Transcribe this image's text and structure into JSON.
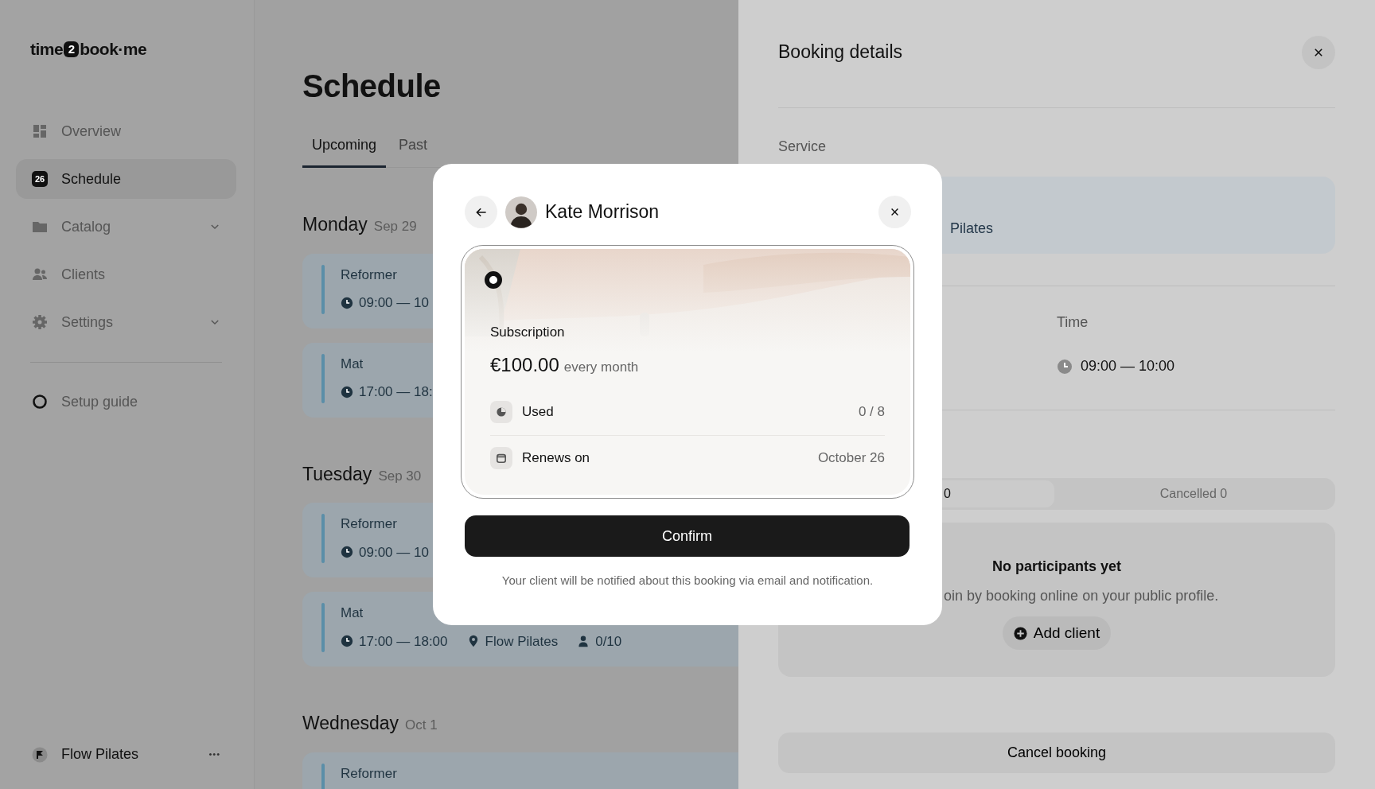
{
  "brand": {
    "logo_left": "time",
    "logo_badge": "2",
    "logo_right": "book·me"
  },
  "sidebar": {
    "items": [
      {
        "label": "Overview",
        "selected": false,
        "expandable": false
      },
      {
        "label": "Schedule",
        "badge": "26",
        "selected": true,
        "expandable": false
      },
      {
        "label": "Catalog",
        "selected": false,
        "expandable": true
      },
      {
        "label": "Clients",
        "selected": false,
        "expandable": false
      },
      {
        "label": "Settings",
        "selected": false,
        "expandable": true
      }
    ],
    "setup_guide": "Setup guide",
    "account": {
      "name": "Flow Pilates",
      "menu_glyph": "•••"
    }
  },
  "schedule": {
    "title": "Schedule",
    "tabs": [
      {
        "label": "Upcoming",
        "selected": true
      },
      {
        "label": "Past",
        "selected": false
      }
    ],
    "days": [
      {
        "day": "Monday",
        "date": "Sep 29",
        "events": [
          {
            "title": "Reformer",
            "time": "09:00 — 10"
          },
          {
            "title": "Mat",
            "time": "17:00 — 18:"
          }
        ]
      },
      {
        "day": "Tuesday",
        "date": "Sep 30",
        "events": [
          {
            "title": "Reformer",
            "time": "09:00 — 10"
          },
          {
            "title": "Mat",
            "time": "17:00 — 18:00",
            "location": "Flow Pilates",
            "capacity": "0/10"
          }
        ]
      },
      {
        "day": "Wednesday",
        "date": "Oct 1",
        "events": [
          {
            "title": "Reformer"
          }
        ]
      }
    ]
  },
  "booking": {
    "title": "Booking details",
    "service_label": "Service",
    "service_value": "Pilates",
    "time_label": "Time",
    "time_value": "09:00 — 10:00",
    "participant_tabs": [
      {
        "label": "0",
        "selected": true
      },
      {
        "label": "Cancelled 0",
        "selected": false
      }
    ],
    "empty_title": "No participants yet",
    "empty_text": "oin by booking online on your public profile.",
    "add_button": "Add client",
    "cancel_button": "Cancel booking"
  },
  "modal": {
    "client_name": "Kate Morrison",
    "plan": {
      "selected": true,
      "title": "Subscription",
      "price": "€100.00",
      "period": "every month",
      "rows": [
        {
          "kind": "usage",
          "label": "Used",
          "value": "0 / 8"
        },
        {
          "kind": "renewal",
          "label": "Renews on",
          "value": "October 26"
        }
      ]
    },
    "confirm": "Confirm",
    "note": "Your client will be notified about this booking via email and notification."
  }
}
